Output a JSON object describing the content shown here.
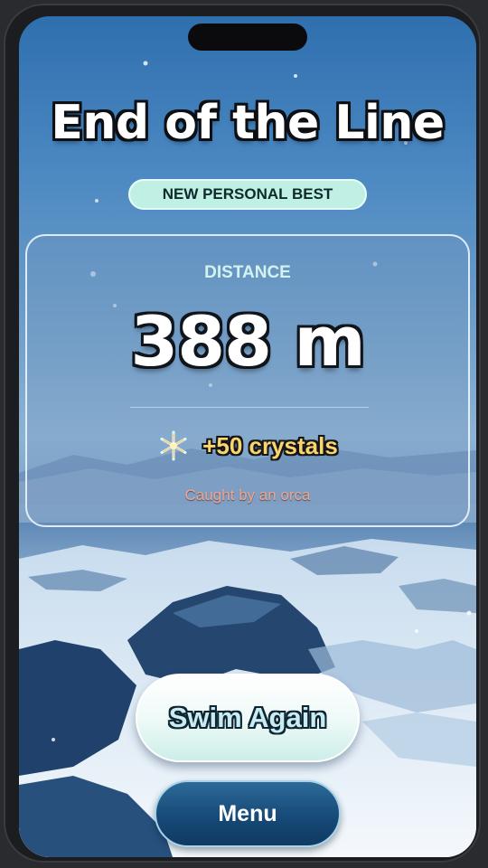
{
  "game": {
    "title": "End of the Line",
    "badge": "NEW PERSONAL BEST",
    "result": {
      "label": "DISTANCE",
      "value": "388 m",
      "reward": "+50 crystals",
      "reward_icon": "snowflake-crystal-icon",
      "cause": "Caught by an orca"
    },
    "buttons": {
      "primary": "Swim Again",
      "secondary": "Menu"
    }
  },
  "colors": {
    "badge_bg": "#bff0e3",
    "label": "#d4f3ee",
    "reward": "#f9d56a",
    "cause": "#f2a58f",
    "menu_button": "#174a78"
  }
}
